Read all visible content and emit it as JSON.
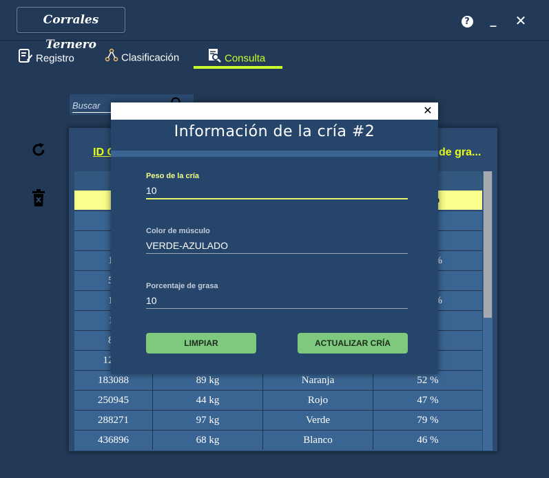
{
  "app": {
    "title": "Corrales Ternero"
  },
  "window": {
    "help": "?",
    "minimize": "_",
    "close": "✕"
  },
  "tabs": [
    {
      "label": "Registro",
      "icon": "edit-form-icon"
    },
    {
      "label": "Clasificación",
      "icon": "tree-icon"
    },
    {
      "label": "Consulta",
      "icon": "search-document-icon",
      "active": true
    }
  ],
  "search": {
    "placeholder": "Buscar"
  },
  "table": {
    "visible_titles": {
      "id": "ID C",
      "grasa": "de gra..."
    },
    "rows": [
      {
        "id": "183088",
        "peso": "89 kg",
        "color": "Naranja",
        "grasa": "52 %"
      },
      {
        "id": "250945",
        "peso": "44 kg",
        "color": "Rojo",
        "grasa": "47 %"
      },
      {
        "id": "288271",
        "peso": "97 kg",
        "color": "Verde",
        "grasa": "79 %"
      },
      {
        "id": "436896",
        "peso": "68 kg",
        "color": "Blanco",
        "grasa": "46 %"
      }
    ],
    "partial_rows": [
      {
        "id": "1",
        "grasa": ""
      },
      {
        "id": "1",
        "grasa": ""
      },
      {
        "id": "12",
        "grasa": "%"
      },
      {
        "id": "54",
        "grasa": ""
      },
      {
        "id": "12",
        "grasa": "%"
      },
      {
        "id": "11",
        "grasa": ""
      },
      {
        "id": "88",
        "grasa": ""
      },
      {
        "id": "121",
        "grasa": ""
      }
    ],
    "selected_row_tail": "%"
  },
  "dialog": {
    "title": "Información de la cría #2",
    "close": "✕",
    "fields": {
      "peso": {
        "label": "Peso de la cría",
        "value": "10"
      },
      "color": {
        "label": "Color de músculo",
        "value": "VERDE-AZULADO"
      },
      "grasa": {
        "label": "Porcentaje de grasa",
        "value": "10"
      }
    },
    "buttons": {
      "limpiar": "LIMPIAR",
      "actualizar": "ACTUALIZAR CRÍA"
    }
  },
  "colors": {
    "background": "#223a57",
    "accent": "#c8ff2d",
    "button": "#7fc97f",
    "selected_row": "#f8ff8a"
  }
}
